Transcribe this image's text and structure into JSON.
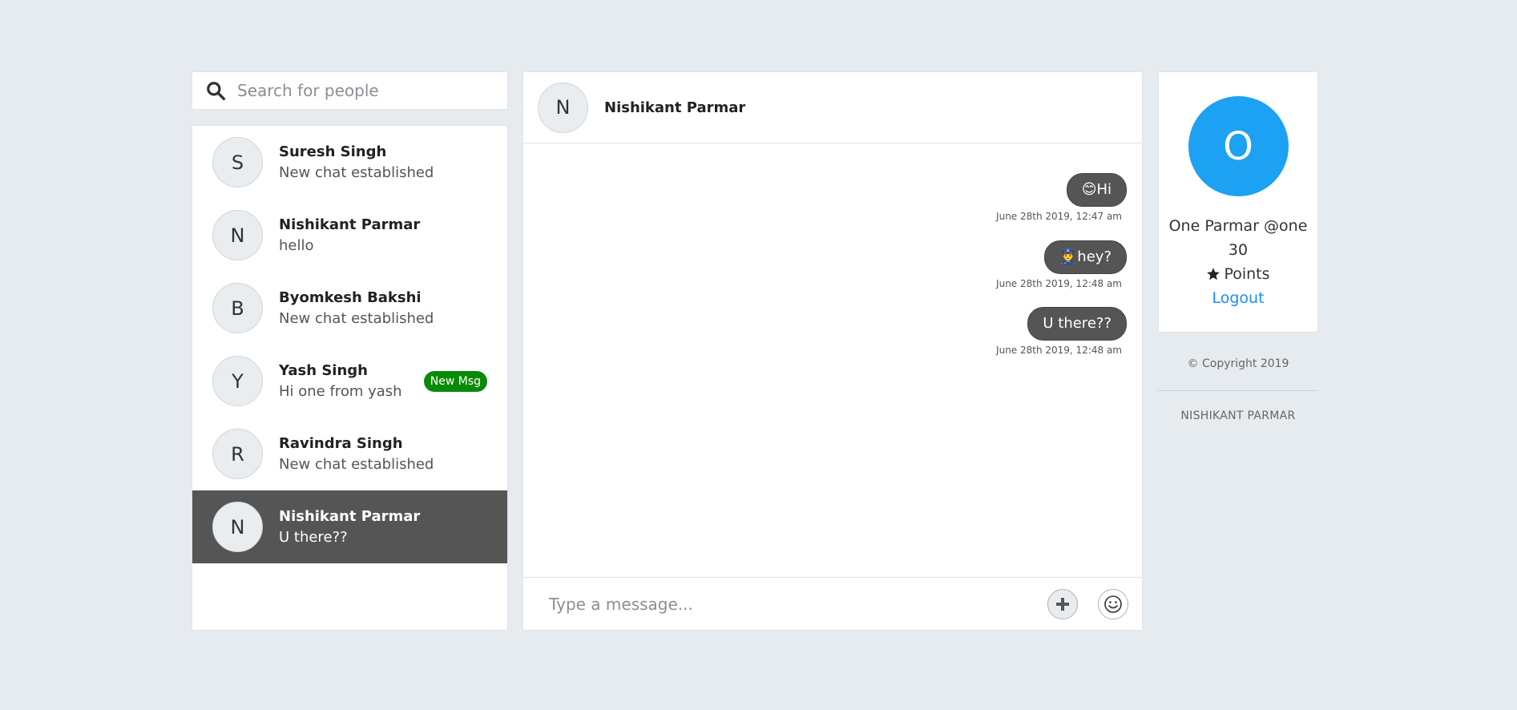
{
  "search": {
    "placeholder": "Search for people",
    "icon": "search-icon"
  },
  "contacts": [
    {
      "initial": "S",
      "name": "Suresh Singh",
      "last_message": "New chat established"
    },
    {
      "initial": "N",
      "name": "Nishikant Parmar",
      "last_message": "hello"
    },
    {
      "initial": "B",
      "name": "Byomkesh Bakshi",
      "last_message": "New chat established"
    },
    {
      "initial": "Y",
      "name": "Yash Singh",
      "last_message": "Hi one from yash",
      "badge": "New Msg"
    },
    {
      "initial": "R",
      "name": "Ravindra Singh",
      "last_message": "New chat established"
    },
    {
      "initial": "N",
      "name": "Nishikant Parmar",
      "last_message": "U there??",
      "active": true
    }
  ],
  "chat": {
    "header": {
      "initial": "N",
      "name": "Nishikant Parmar"
    },
    "messages": [
      {
        "text": "😊Hi",
        "time": "June 28th 2019, 12:47 am"
      },
      {
        "text": "👮hey?",
        "time": "June 28th 2019, 12:48 am"
      },
      {
        "text": "U there??",
        "time": "June 28th 2019, 12:48 am"
      }
    ],
    "composer": {
      "placeholder": "Type a message...",
      "attach_icon": "plus-icon",
      "emoji_icon": "smiley-icon"
    }
  },
  "profile": {
    "initial": "O",
    "name": "One Parmar @one",
    "name_line2": "30",
    "points_label": "Points",
    "points_icon": "star-icon",
    "logout_label": "Logout",
    "avatar_color": "#1da1f2"
  },
  "footer": {
    "copyright": "© Copyright 2019",
    "author": "NISHIKANT PARMAR"
  },
  "colors": {
    "background": "#e6ebef",
    "active_row": "#555555",
    "badge": "#0a8a0a",
    "link": "#1a8cff"
  }
}
